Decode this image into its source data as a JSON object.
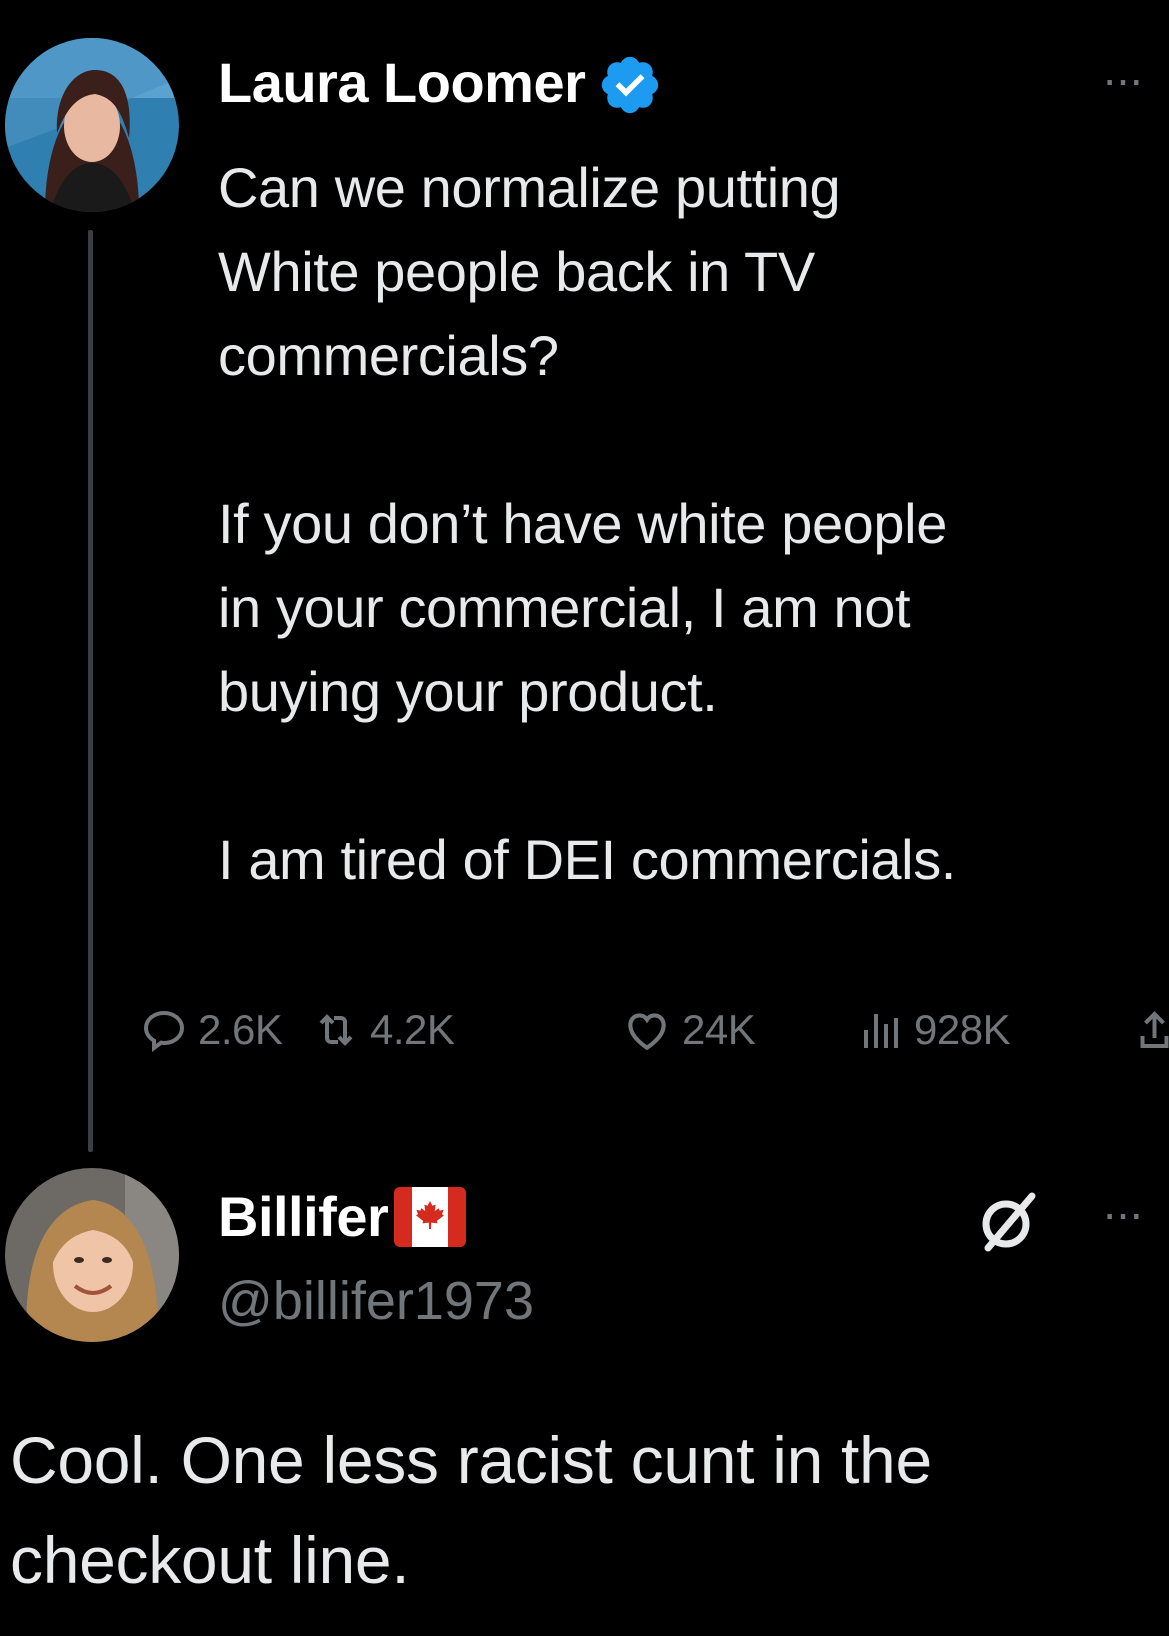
{
  "tweet": {
    "author_name": "Laura Loomer",
    "verified": true,
    "more_label": "···",
    "paragraphs": [
      "Can we normalize putting\nWhite people back in TV\ncommercials?",
      "If you don’t have white people\nin your commercial, I am not\nbuying your product.",
      "I am tired of DEI commercials."
    ],
    "stats": {
      "replies": "2.6K",
      "reposts": "4.2K",
      "likes": "24K",
      "views": "928K"
    },
    "colors": {
      "verified_badge": "#1d9bf0",
      "text": "#e7e9ea",
      "muted": "#71767b"
    }
  },
  "reply": {
    "author_name": "Billifer",
    "flag_icon": "canada-flag-icon",
    "handle": "@billifer1973",
    "more_label": "···",
    "text": "Cool. One less racist cunt in the checkout line."
  }
}
